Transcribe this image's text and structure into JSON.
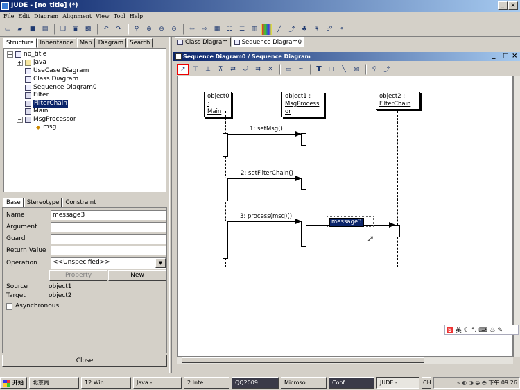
{
  "window": {
    "title": "JUDE - [no_title] (*)"
  },
  "menu": [
    "File",
    "Edit",
    "Diagram",
    "Alignment",
    "View",
    "Tool",
    "Help"
  ],
  "left_tabs": [
    "Structure",
    "Inheritance",
    "Map",
    "Diagram",
    "Search"
  ],
  "tree": {
    "root": "no_title",
    "items": [
      "java",
      "UseCase Diagram",
      "Class Diagram",
      "Sequence Diagram0",
      "Filter",
      "FilterChain",
      "Main",
      "MsgProcessor",
      "msg"
    ]
  },
  "prop_tabs": [
    "Base",
    "Stereotype",
    "Constraint"
  ],
  "props": {
    "labels": {
      "name": "Name",
      "argument": "Argument",
      "guard": "Guard",
      "return_value": "Return Value",
      "operation": "Operation",
      "source": "Source",
      "target": "Target"
    },
    "name_value": "message3",
    "operation_value": "<<Unspecified>>",
    "property_button": "Property",
    "new_button": "New",
    "source_value": "object1",
    "target_value": "object2",
    "async_label": "Asynchronous",
    "close_button": "Close"
  },
  "diagram_tabs": [
    "Class Diagram",
    "Sequence Diagram0"
  ],
  "diagram_title": "Sequence Diagram0 / Sequence Diagram",
  "objects": [
    {
      "line1": "object0 :",
      "line2": "Main",
      "line3": ""
    },
    {
      "line1": "object1 :",
      "line2": "MsgProcess",
      "line3": "or"
    },
    {
      "line1": "object2 :",
      "line2": "FilterChain",
      "line3": ""
    }
  ],
  "messages": [
    "1: setMsg()",
    "2: setFilterChain()",
    "3: process(msg)()"
  ],
  "editing_message": "message3",
  "ime": {
    "label": "英"
  },
  "taskbar": {
    "start": "开始",
    "tasks": [
      "北京尚...",
      "12 Win...",
      "Java - ...",
      "2 Inte...",
      "QQ2009",
      "Microso...",
      "Coof...",
      "JUDE - ..."
    ],
    "clock": "下午 09:26",
    "lang": "CH"
  }
}
